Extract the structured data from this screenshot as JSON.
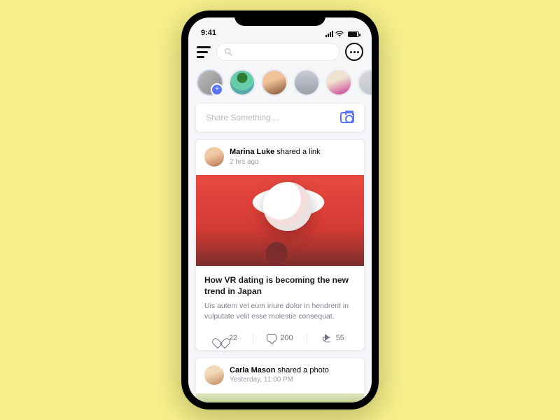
{
  "status": {
    "time": "9:41"
  },
  "search": {
    "placeholder": ""
  },
  "compose": {
    "placeholder": "Share Something…"
  },
  "posts": [
    {
      "author": "Marina Luke",
      "action": "shared a link",
      "time": "2 hrs ago",
      "title": "How VR dating is becoming the new trend in Japan",
      "excerpt": "Uis autem vel eum iriure dolor in hendrerit in vulputate velit esse molestie consequat.",
      "likes": "22",
      "comments": "200",
      "shares": "55"
    },
    {
      "author": "Carla Mason",
      "action": "shared a photo",
      "time": "Yesterday, 11:00 PM"
    }
  ]
}
